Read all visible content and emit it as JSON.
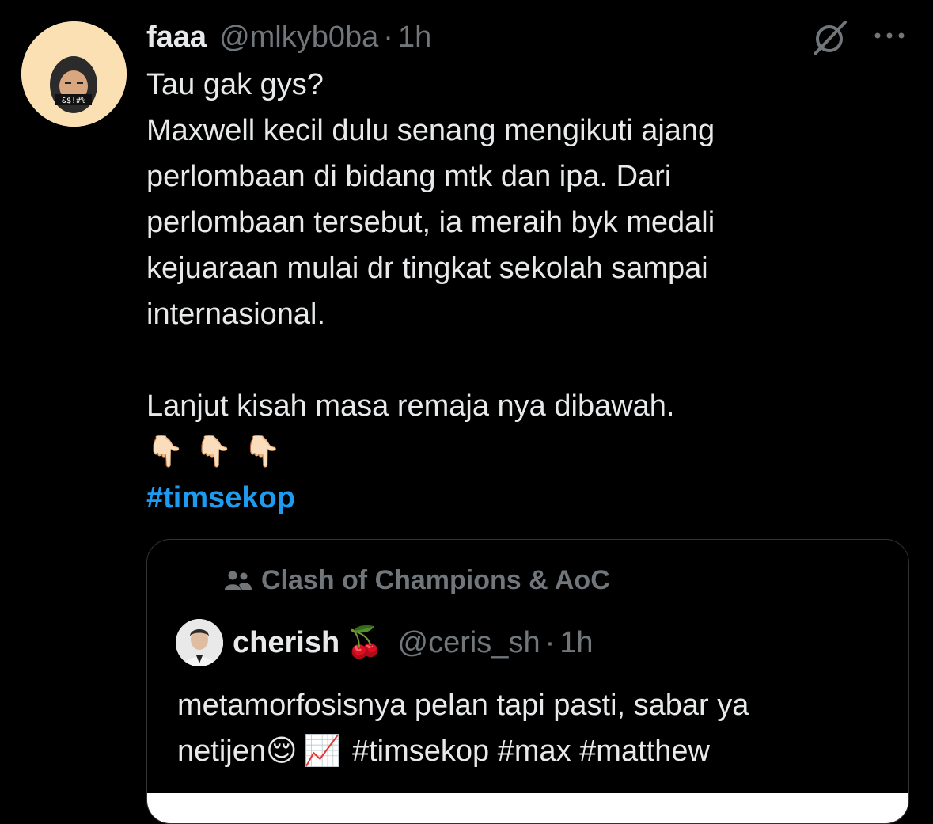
{
  "tweet": {
    "author": {
      "display_name": "faaa",
      "handle": "@mlkyb0ba",
      "separator": "·",
      "time": "1h",
      "avatar_text": "&$!#%"
    },
    "text_lines": [
      "Tau gak gys?",
      "Maxwell kecil dulu senang mengikuti ajang",
      "perlombaan di bidang mtk dan ipa. Dari",
      "perlombaan tersebut, ia meraih byk medali",
      "kejuaraan mulai dr tingkat sekolah sampai",
      "internasional.",
      "Lanjut kisah masa remaja nya dibawah."
    ],
    "emojis": [
      "👇🏻",
      "👇🏻",
      "👇🏻"
    ],
    "hashtag": "#timsekop",
    "icons": {
      "grok": "grok-icon",
      "more": "more-icon"
    }
  },
  "quote": {
    "community": "Clash of Champions & AoC",
    "author": {
      "display_name": "cherish",
      "name_emoji": "🍒",
      "handle": "@ceris_sh",
      "separator": "·",
      "time": "1h"
    },
    "line1": "metamorfosisnya pelan tapi pasti, sabar ya",
    "line2_prefix": "netijen",
    "line2_emoji1": "😌",
    "line2_emoji2": "📈",
    "line2_suffix": "#timsekop #max #matthew"
  },
  "colors": {
    "background": "#000000",
    "text": "#e7e9ea",
    "secondary": "#71767b",
    "link": "#1d9bf0",
    "border": "#2f3336",
    "avatar_bg": "#fbe0b4"
  }
}
